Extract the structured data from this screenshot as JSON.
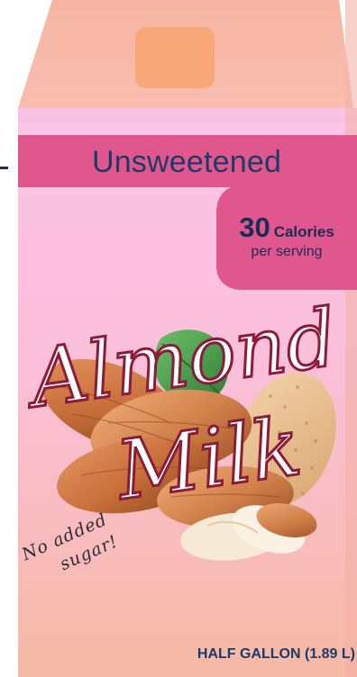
{
  "carton": {
    "variant_label": "Unsweetened",
    "calories_number": "30",
    "calories_unit": "Calories",
    "calories_note": "per serving",
    "title_line1": "Almond",
    "title_line2": "Milk",
    "claim_line1": "No added",
    "claim_line2": "sugar!",
    "size": "HALF GALLON (1.89 L)"
  },
  "colors": {
    "top_panel": "#f8b8a8",
    "cap": "#f8a878",
    "band": "#e0578d",
    "front_top": "#fbc2e2",
    "front_bottom": "#f6b8a6",
    "title_fill": "#ffffff",
    "title_outline": "#8a1c38",
    "text_navy": "#1e3a6a"
  }
}
